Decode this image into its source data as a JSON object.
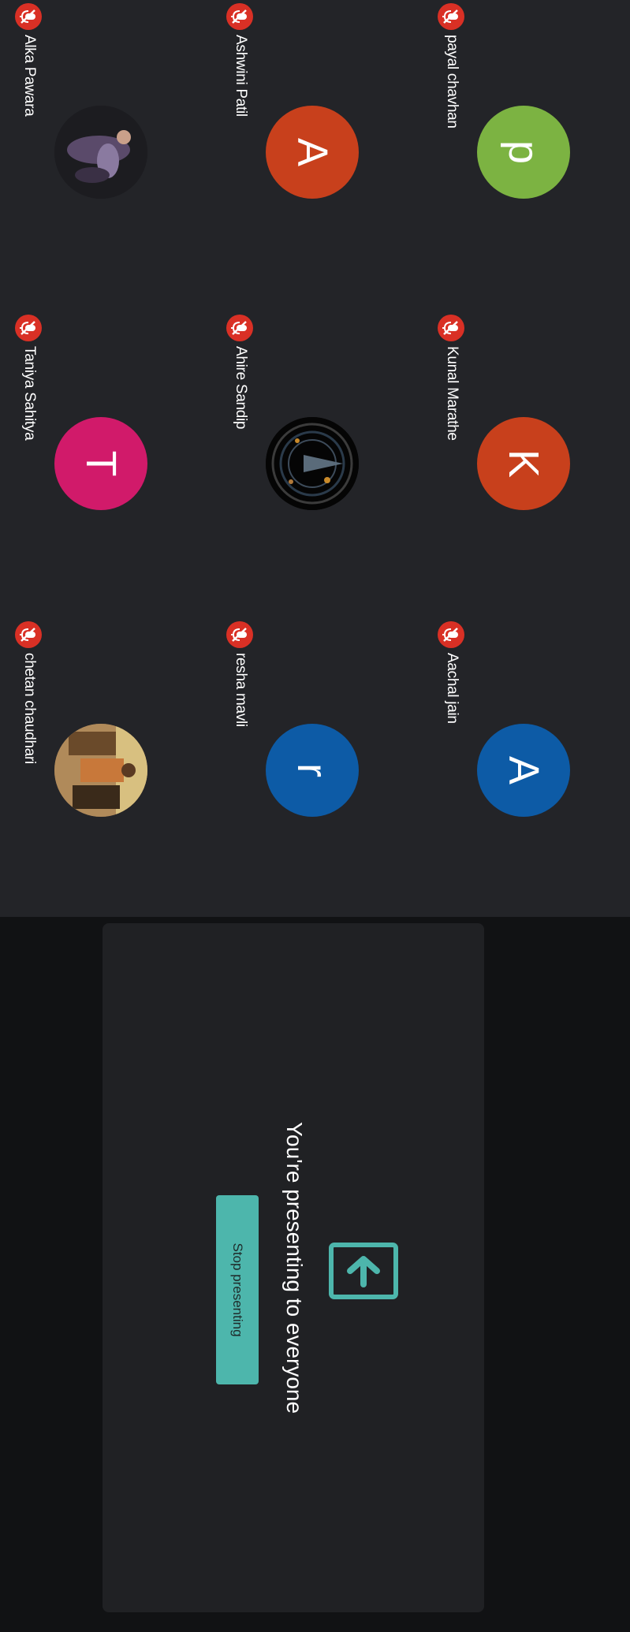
{
  "participants": [
    {
      "name": "payal chavhan",
      "initial": "p",
      "color": "#7cb342",
      "kind": "letter"
    },
    {
      "name": "Kunal Marathe",
      "initial": "K",
      "color": "#c8401c",
      "kind": "letter"
    },
    {
      "name": "Aachal jain",
      "initial": "A",
      "color": "#0d5ba6",
      "kind": "letter"
    },
    {
      "name": "Ashwini Patil",
      "initial": "A",
      "color": "#c8401c",
      "kind": "letter"
    },
    {
      "name": "Ahire Sandip",
      "initial": "",
      "color": "#0a0a0a",
      "kind": "photo"
    },
    {
      "name": "resha mavli",
      "initial": "r",
      "color": "#0d5ba6",
      "kind": "letter"
    },
    {
      "name": "Alka Pawara",
      "initial": "",
      "color": "#1e1e22",
      "kind": "photo"
    },
    {
      "name": "Taniya Sahitya",
      "initial": "T",
      "color": "#d11a6a",
      "kind": "letter"
    },
    {
      "name": "chetan chaudhari",
      "initial": "",
      "color": "#8a6a48",
      "kind": "photo"
    }
  ],
  "mic_status_icon": "mic-off-icon",
  "presentation": {
    "icon": "present-arrow-icon",
    "title": "You're presenting to everyone",
    "button_label": "Stop presenting",
    "accent_color": "#4db6ac"
  }
}
